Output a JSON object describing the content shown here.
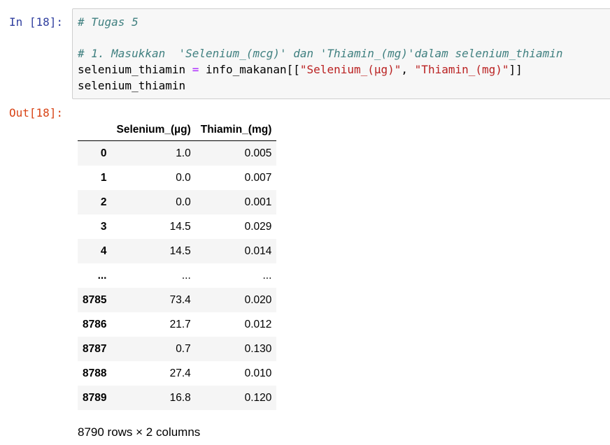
{
  "cell": {
    "in_prompt": "In [18]:",
    "out_prompt": "Out[18]:",
    "code": {
      "line1_comment": "# Tugas 5",
      "line3_comment": "# 1. Masukkan  'Selenium_(mcg)' dan 'Thiamin_(mg)'dalam selenium_thiamin",
      "line4": {
        "var": "selenium_thiamin ",
        "op": "=",
        "expr_start": " info_makanan[[",
        "str1": "\"Selenium_(µg)\"",
        "sep": ", ",
        "str2": "\"Thiamin_(mg)\"",
        "expr_end": "]]"
      },
      "line5": "selenium_thiamin"
    }
  },
  "dataframe": {
    "index_header": "",
    "columns": [
      "Selenium_(µg)",
      "Thiamin_(mg)"
    ],
    "rows": [
      {
        "index": "0",
        "values": [
          "1.0",
          "0.005"
        ]
      },
      {
        "index": "1",
        "values": [
          "0.0",
          "0.007"
        ]
      },
      {
        "index": "2",
        "values": [
          "0.0",
          "0.001"
        ]
      },
      {
        "index": "3",
        "values": [
          "14.5",
          "0.029"
        ]
      },
      {
        "index": "4",
        "values": [
          "14.5",
          "0.014"
        ]
      },
      {
        "index": "...",
        "values": [
          "...",
          "..."
        ]
      },
      {
        "index": "8785",
        "values": [
          "73.4",
          "0.020"
        ]
      },
      {
        "index": "8786",
        "values": [
          "21.7",
          "0.012"
        ]
      },
      {
        "index": "8787",
        "values": [
          "0.7",
          "0.130"
        ]
      },
      {
        "index": "8788",
        "values": [
          "27.4",
          "0.010"
        ]
      },
      {
        "index": "8789",
        "values": [
          "16.8",
          "0.120"
        ]
      }
    ],
    "shape_text": "8790 rows × 2 columns"
  }
}
